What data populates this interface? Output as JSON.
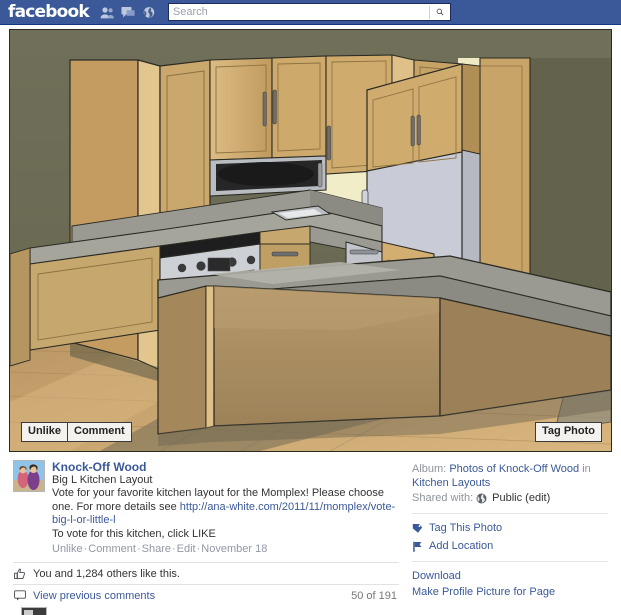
{
  "header": {
    "logo": "facebook",
    "icons": [
      "friend-requests-icon",
      "messages-icon",
      "notifications-globe-icon"
    ],
    "search": {
      "placeholder": "Search",
      "value": "",
      "button_icon": "search-magnifier-icon"
    },
    "colors": {
      "chrome_blue": "#3b5998",
      "chrome_border": "#133783"
    }
  },
  "photo": {
    "alt": "3D rendered kitchen layout with wood cabinets, island, stainless range and refrigerator",
    "buttons": {
      "unlike": "Unlike",
      "comment": "Comment",
      "tag_photo": "Tag Photo"
    },
    "colors": {
      "wall": "#6e6e55",
      "wall_shadow": "#5f5f49",
      "cabinet_light": "#d8b97f",
      "cabinet_mid": "#c9a96c",
      "cabinet_face": "#c4a168",
      "cabinet_dark": "#a98a52",
      "counter": "#8b8b83",
      "counter_light": "#a5a59c",
      "stainless": "#c9ccd1",
      "appliance_dark": "#2c2c2c",
      "floor_light": "#d8b278",
      "floor_mid": "#c09a62",
      "floor_dark": "#7e7358",
      "wall_cream": "#f2edc9",
      "outline": "#2b2b24"
    }
  },
  "post": {
    "author": "Knock-Off Wood",
    "avatar_name": "knock-off-wood-avatar",
    "caption_title": "Big L Kitchen Layout",
    "caption_line1": "Vote for your favorite kitchen layout for the Momplex! Please choose one. For more details see ",
    "caption_link": "http://ana-white.com/2011/11/momplex/vote-big-l-or-little-l",
    "caption_line2": "To vote for this kitchen, click LIKE",
    "actions": [
      "Unlike",
      "Comment",
      "Share",
      "Edit"
    ],
    "date": "November 18",
    "likes": {
      "icon": "thumbs-up-icon",
      "text": "You and 1,284 others like this."
    },
    "comments": {
      "icon": "comment-bubble-icon",
      "view_previous": "View previous comments",
      "count_label": "50 of 191"
    }
  },
  "sidebar": {
    "album_label": "Album:",
    "album_name": "Photos of Knock-Off Wood",
    "album_in": "in",
    "album_category": "Kitchen Layouts",
    "shared_label": "Shared with:",
    "shared_icon": "globe-icon",
    "shared_value": "Public (edit)",
    "actions": [
      {
        "icon": "tag-icon",
        "label": "Tag This Photo"
      },
      {
        "icon": "location-pin-icon",
        "label": "Add Location"
      }
    ],
    "links": [
      "Download",
      "Make Profile Picture for Page"
    ]
  }
}
